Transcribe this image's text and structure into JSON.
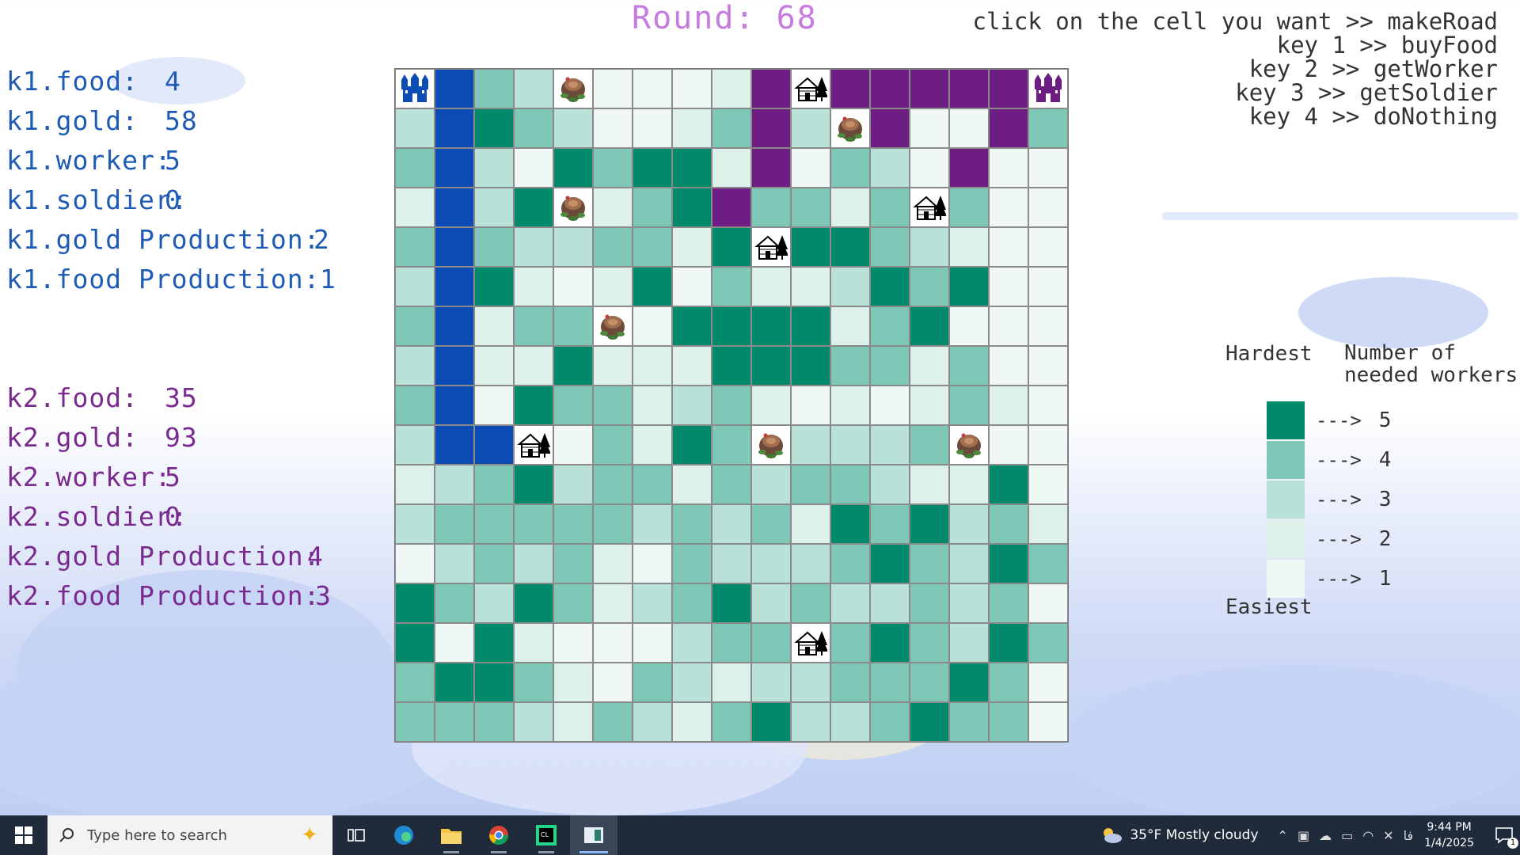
{
  "round": {
    "text": "Round: 68"
  },
  "instructions": [
    "click on the cell you want >> makeRoad",
    "key 1 >> buyFood",
    "key 2 >> getWorker",
    "key 3 >> getSoldier",
    "key 4 >> doNothing"
  ],
  "kingdom1": {
    "stats": [
      {
        "label": "k1.food:",
        "value": "4"
      },
      {
        "label": "k1.gold:",
        "value": "58"
      },
      {
        "label": "k1.worker:",
        "value": "5"
      },
      {
        "label": "k1.soldier:",
        "value": "0"
      },
      {
        "label": "k1.gold Production:",
        "value": "2"
      },
      {
        "label": "k1.food Production:",
        "value": "1"
      }
    ],
    "color": "#0b4db5"
  },
  "kingdom2": {
    "stats": [
      {
        "label": "k2.food:",
        "value": "35"
      },
      {
        "label": "k2.gold:",
        "value": "93"
      },
      {
        "label": "k2.worker:",
        "value": "5"
      },
      {
        "label": "k2.soldier:",
        "value": "0"
      },
      {
        "label": "k2.gold Production:",
        "value": "4"
      },
      {
        "label": "k2.food Production:",
        "value": "3"
      }
    ],
    "color": "#6e1e82"
  },
  "legend": {
    "hardest": "Hardest",
    "workers_title_line1": "Number of",
    "workers_title_line2": "needed workers",
    "easiest": "Easiest",
    "arrow": "--->",
    "levels": [
      {
        "workers": "5",
        "color": "#008a6b"
      },
      {
        "workers": "4",
        "color": "#7fc8b7"
      },
      {
        "workers": "3",
        "color": "#b9e1d7"
      },
      {
        "workers": "2",
        "color": "#ddf0ea"
      },
      {
        "workers": "1",
        "color": "#eff8f5"
      }
    ]
  },
  "board": {
    "size": 17,
    "cell_codes": "1=difficulty1..5=difficulty5, A=kingdom1 road, P=kingdom2 road, C=castle1, D=castle2, H=house, T=tree",
    "rows": [
      "CA43T1112PHPPPPPD",
      "3A5431124P3TP1.P4",
      "4A3154552P1431P1",
      "2A35T245P4424H4",
      "4A4334425H55432",
      "3A5212514223545",
      "4A244T15555245",
      "3A2252225554424",
      "4A15442342121242",
      "3AAH14254T3334T",
      "2345344243443225",
      "34444434342545342",
      "13434214333454354",
      "5435423453433434",
      "5152111344H454354",
      "4554214323344454",
      "4443243245334544"
    ]
  },
  "taskbar": {
    "search_placeholder": "Type here to search",
    "weather": "35°F  Mostly cloudy",
    "time": "9:44 PM",
    "date": "1/4/2025",
    "lang": "فا",
    "notifications": "1"
  }
}
